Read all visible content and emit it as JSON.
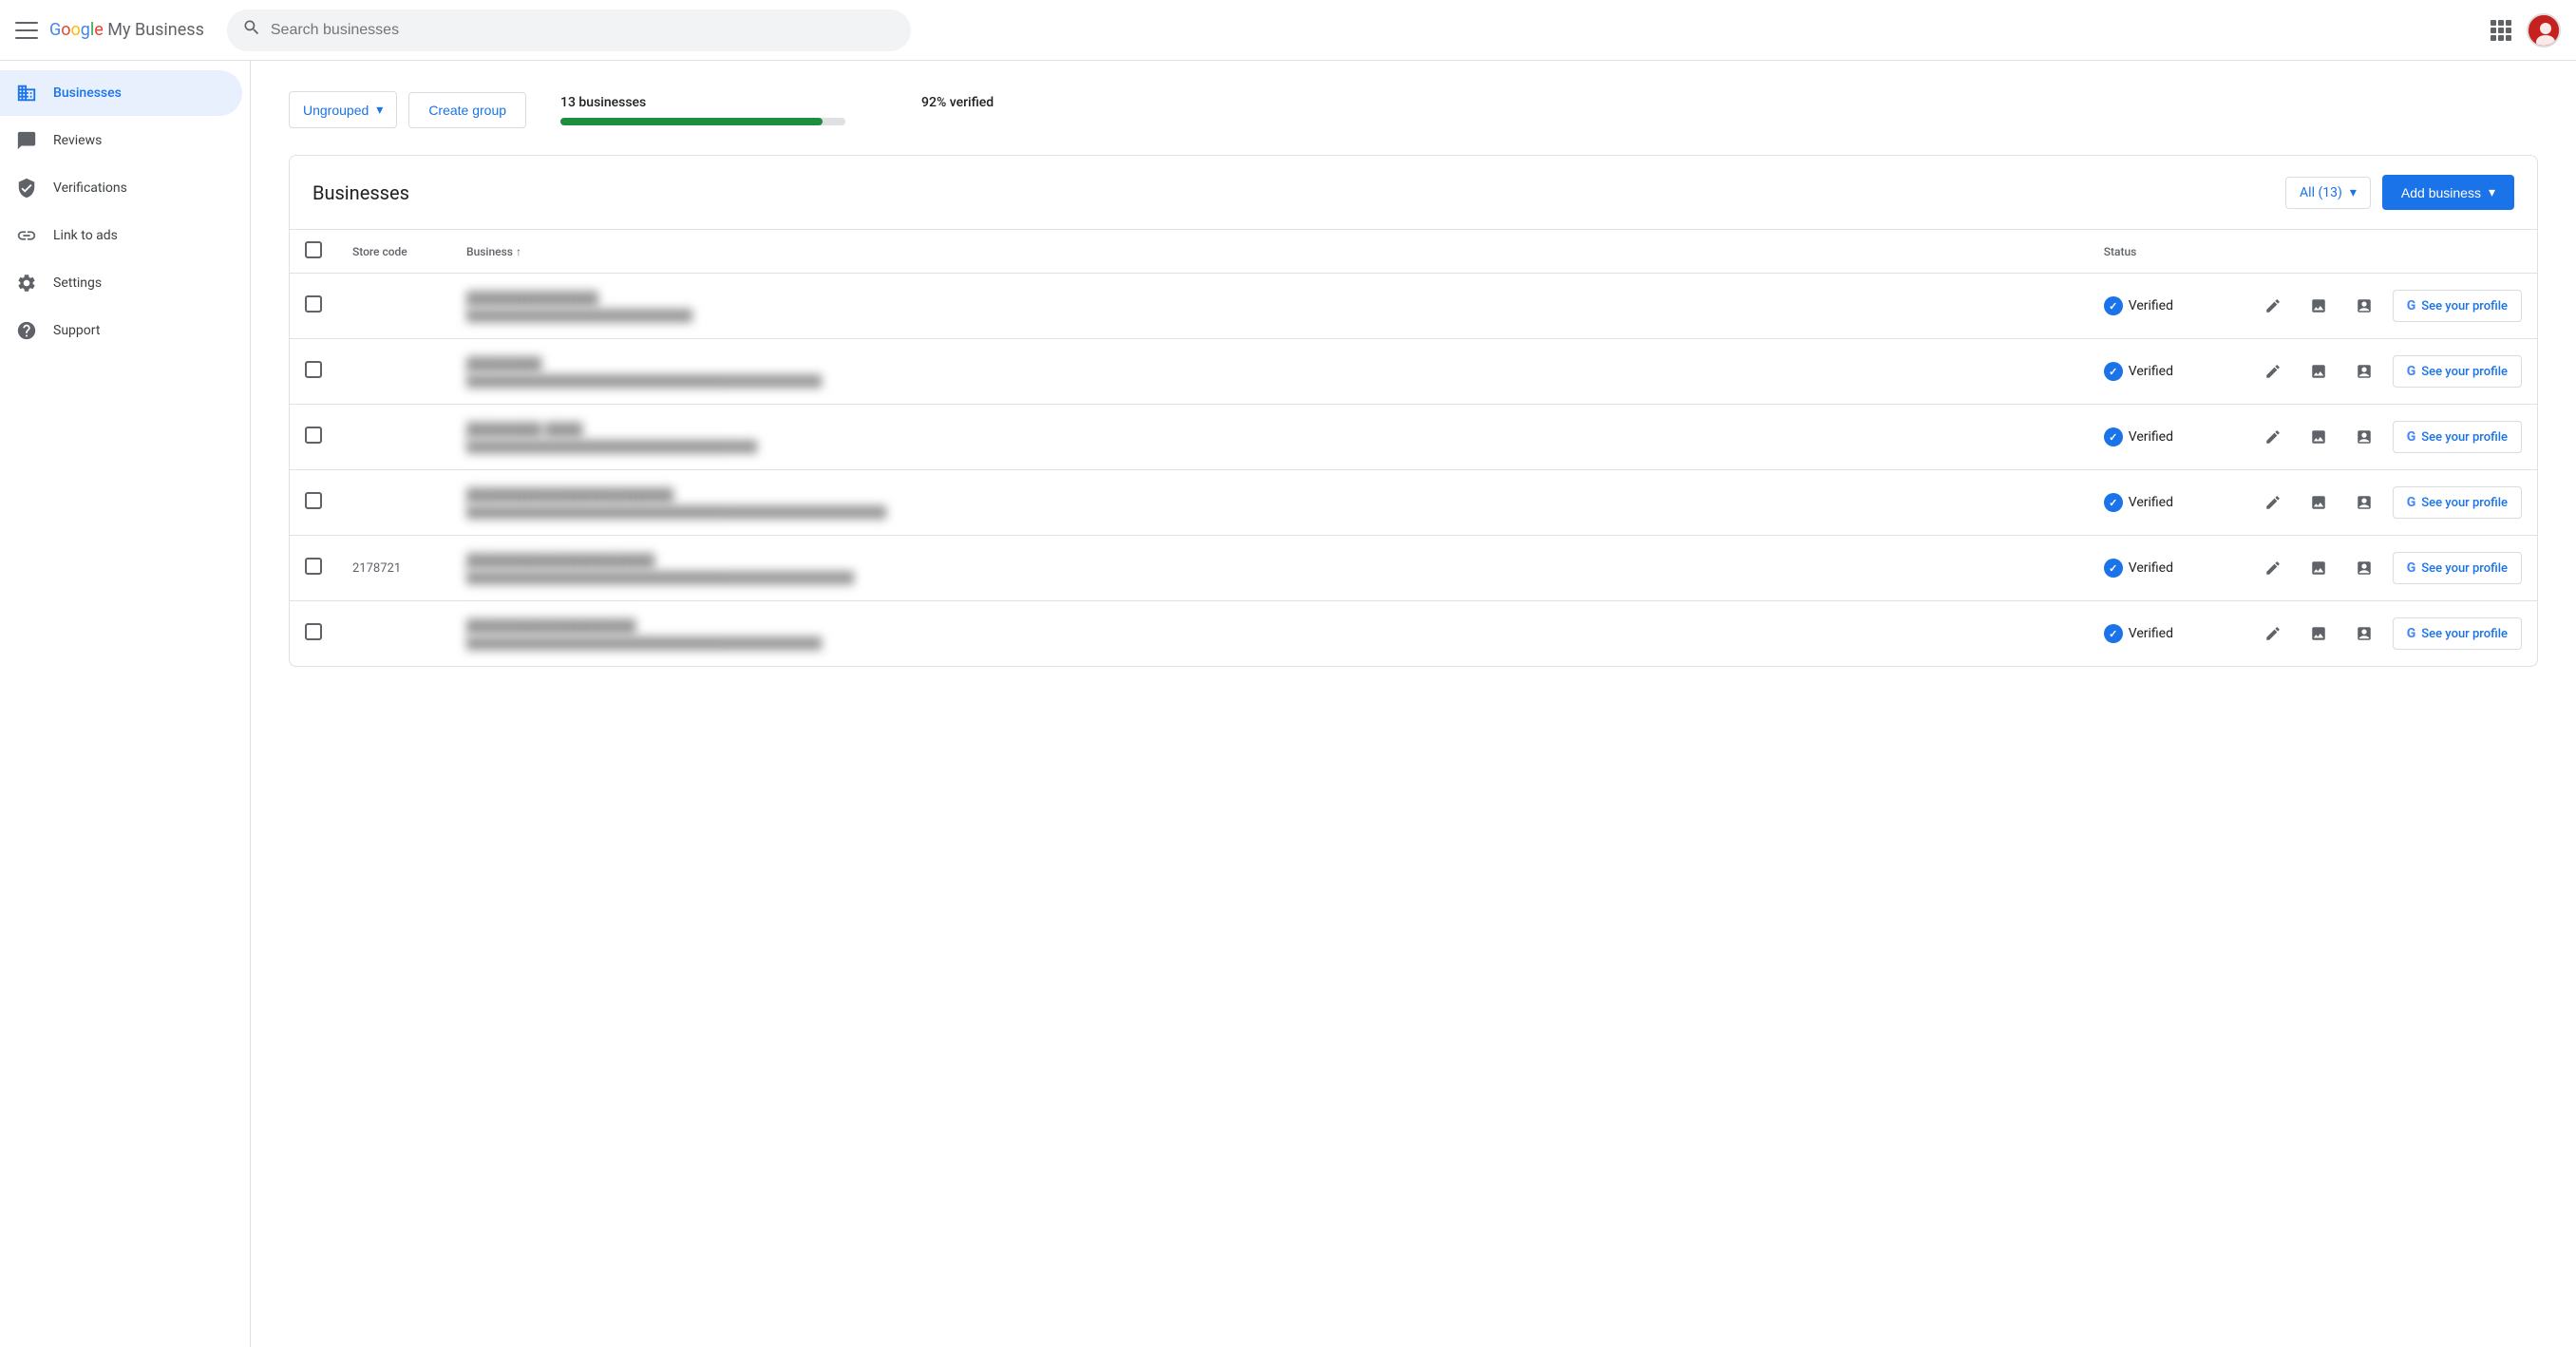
{
  "app": {
    "title": "Google My Business",
    "logo_parts": [
      "G",
      "o",
      "o",
      "g",
      "l",
      "e"
    ],
    "brand": " My Business"
  },
  "topnav": {
    "search_placeholder": "Search businesses"
  },
  "sidebar": {
    "items": [
      {
        "id": "businesses",
        "label": "Businesses",
        "active": true
      },
      {
        "id": "reviews",
        "label": "Reviews",
        "active": false
      },
      {
        "id": "verifications",
        "label": "Verifications",
        "active": false
      },
      {
        "id": "link-to-ads",
        "label": "Link to ads",
        "active": false
      },
      {
        "id": "settings",
        "label": "Settings",
        "active": false
      },
      {
        "id": "support",
        "label": "Support",
        "active": false
      }
    ]
  },
  "filter_bar": {
    "dropdown_label": "Ungrouped",
    "create_group_label": "Create group",
    "stats": {
      "businesses_count": "13 businesses",
      "verified_pct": "92% verified",
      "progress_pct": 92
    }
  },
  "businesses_panel": {
    "title": "Businesses",
    "filter_label": "All (13)",
    "add_business_label": "Add business",
    "columns": {
      "checkbox": "",
      "store_code": "Store code",
      "business": "Business",
      "status": "Status",
      "actions": ""
    },
    "rows": [
      {
        "id": 1,
        "store_code": "",
        "business_name": "██████████████",
        "business_addr": "████████████████████████████",
        "status": "Verified",
        "see_profile_label": "See your profile"
      },
      {
        "id": 2,
        "store_code": "",
        "business_name": "████████",
        "business_addr": "████████████████████████████████████████████",
        "status": "Verified",
        "see_profile_label": "See your profile"
      },
      {
        "id": 3,
        "store_code": "",
        "business_name": "████████ ████",
        "business_addr": "████████████████████████████████████",
        "status": "Verified",
        "see_profile_label": "See your profile"
      },
      {
        "id": 4,
        "store_code": "",
        "business_name": "██████████████████████",
        "business_addr": "████████████████████████████████████████████████████",
        "status": "Verified",
        "see_profile_label": "See your profile"
      },
      {
        "id": 5,
        "store_code": "2178721",
        "business_name": "████████████████████",
        "business_addr": "████████████████████████████████████████████████",
        "status": "Verified",
        "see_profile_label": "See your profile"
      },
      {
        "id": 6,
        "store_code": "",
        "business_name": "██████████████████",
        "business_addr": "████████████████████████████████████████████",
        "status": "Verified",
        "see_profile_label": "See your profile"
      }
    ]
  },
  "icons": {
    "pencil": "✏",
    "photo": "🖼",
    "post": "📋",
    "chevron_down": "▾",
    "search": "🔍",
    "g_logo": "G"
  }
}
